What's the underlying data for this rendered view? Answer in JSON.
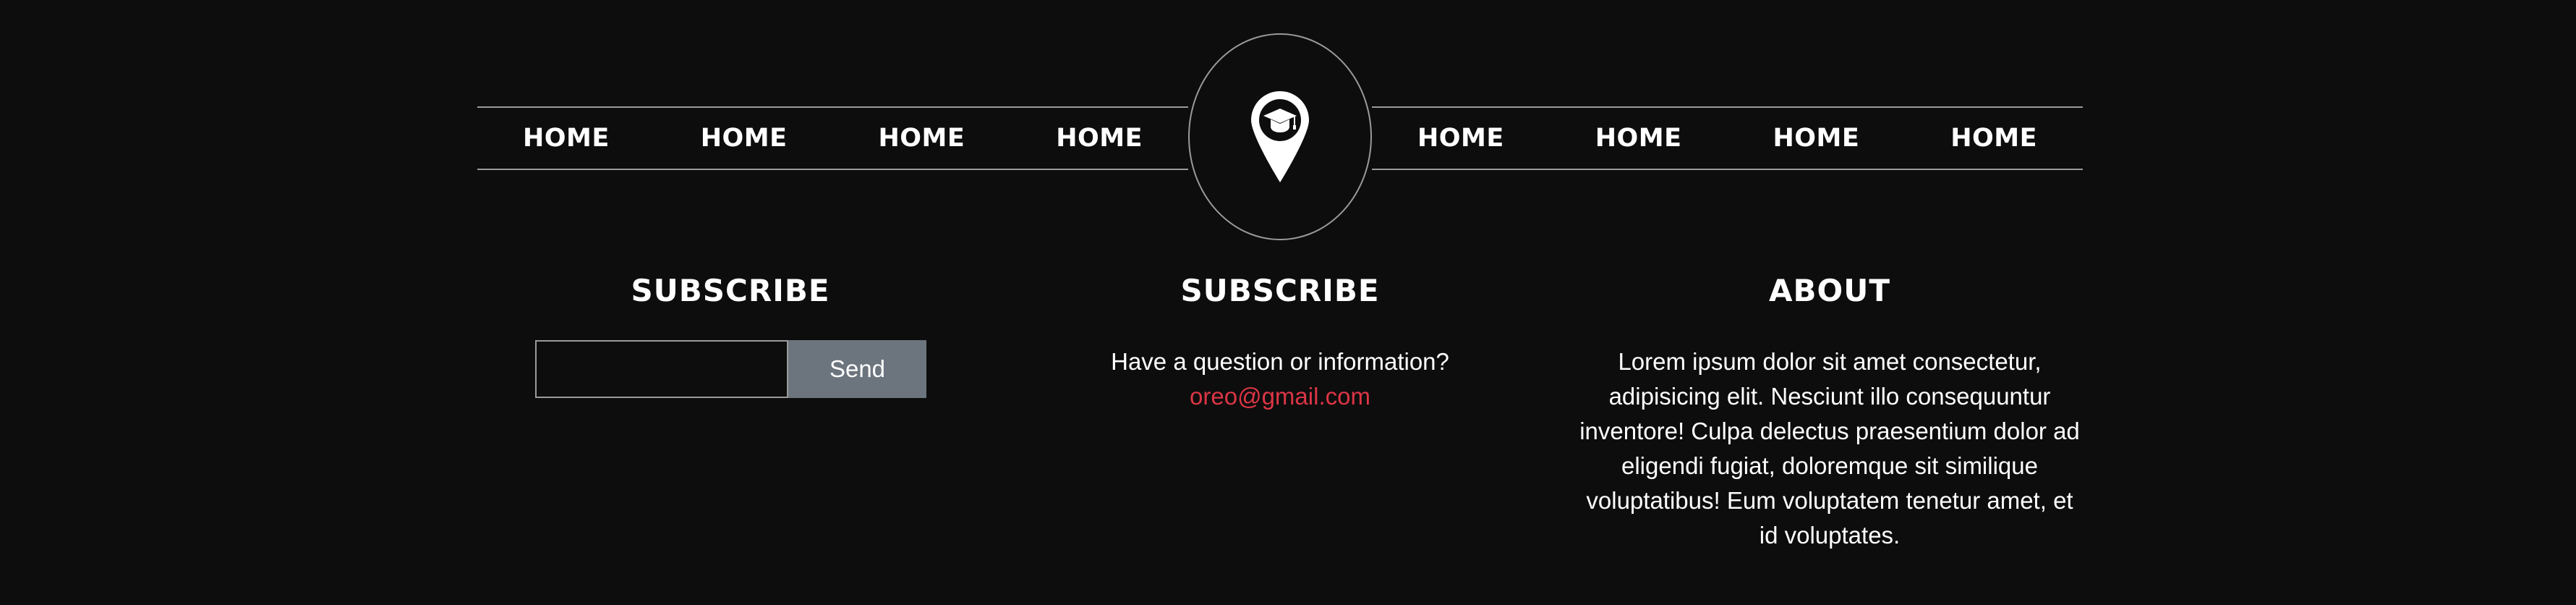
{
  "nav": {
    "left_items": [
      "HOME",
      "HOME",
      "HOME",
      "HOME"
    ],
    "right_items": [
      "HOME",
      "HOME",
      "HOME",
      "HOME"
    ],
    "logo_icon": "graduation-cap-map-pin-icon"
  },
  "footer": {
    "subscribe_form": {
      "title": "SUBSCRIBE",
      "input_value": "",
      "input_placeholder": "",
      "button_label": "Send"
    },
    "contact": {
      "title": "SUBSCRIBE",
      "question": "Have a question or information?",
      "email": "oreo@gmail.com"
    },
    "about": {
      "title": "ABOUT",
      "text": "Lorem ipsum dolor sit amet consectetur, adipisicing elit. Nesciunt illo consequuntur inventore! Culpa delectus praesentium dolor ad eligendi fugiat, doloremque sit similique voluptatibus! Eum voluptatem tenetur amet, et id voluptates."
    }
  },
  "colors": {
    "background": "#0d0d0d",
    "border": "#9a9a9a",
    "button": "#6c757d",
    "email_link": "#dc3545",
    "text": "#ffffff"
  }
}
